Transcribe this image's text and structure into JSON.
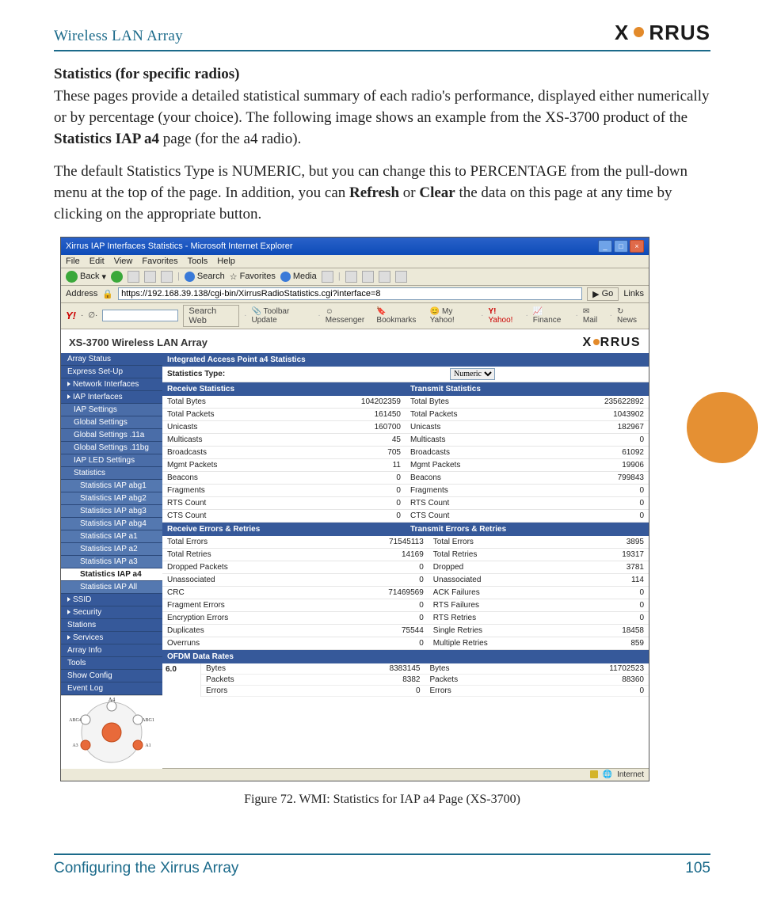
{
  "header": {
    "title": "Wireless LAN Array",
    "logo_pre": "X",
    "logo_post": "RRUS"
  },
  "footer": {
    "section": "Configuring the Xirrus Array",
    "page": "105"
  },
  "content": {
    "heading": "Statistics (for specific radios)",
    "p1a": "These pages provide a detailed statistical summary of each radio's performance, displayed either numerically or by percentage (your choice). The following image shows an example from the XS-3700 product of the ",
    "p1b": "Statistics IAP a4",
    "p1c": " page (for the a4 radio).",
    "p2a": "The default Statistics Type is NUMERIC, but you can change this to PERCENTAGE from the pull-down menu at the top of the page. In addition, you can ",
    "p2b": "Refresh",
    "p2c": " or ",
    "p2d": "Clear",
    "p2e": " the data on this page at any time by clicking on the appropriate button.",
    "caption": "Figure 72. WMI: Statistics for IAP a4 Page (XS-3700)"
  },
  "figure": {
    "window_title": "Xirrus IAP Interfaces Statistics - Microsoft Internet Explorer",
    "menubar": [
      "File",
      "Edit",
      "View",
      "Favorites",
      "Tools",
      "Help"
    ],
    "toolbar": {
      "back": "Back",
      "search": "Search",
      "favorites": "Favorites",
      "media": "Media"
    },
    "address_label": "Address",
    "address_value": "https://192.168.39.138/cgi-bin/XirrusRadioStatistics.cgi?interface=8",
    "go_label": "Go",
    "links_label": "Links",
    "ybar": {
      "search_btn": "Search Web",
      "items": [
        "Toolbar Update",
        "Messenger",
        "Bookmarks",
        "My Yahoo!",
        "Yahoo!",
        "Finance",
        "Mail",
        "News"
      ]
    },
    "array_name": "XS-3700 Wireless LAN Array",
    "sidebar": [
      {
        "t": "Array Status",
        "lvl": 0,
        "tri": false
      },
      {
        "t": "Express Set-Up",
        "lvl": 0,
        "tri": false
      },
      {
        "t": "Network Interfaces",
        "lvl": 0,
        "tri": true
      },
      {
        "t": "IAP Interfaces",
        "lvl": 0,
        "tri": true
      },
      {
        "t": "IAP Settings",
        "lvl": 1
      },
      {
        "t": "Global Settings",
        "lvl": 1
      },
      {
        "t": "Global Settings .11a",
        "lvl": 1
      },
      {
        "t": "Global Settings .11bg",
        "lvl": 1
      },
      {
        "t": "IAP LED Settings",
        "lvl": 1
      },
      {
        "t": "Statistics",
        "lvl": 1
      },
      {
        "t": "Statistics IAP abg1",
        "lvl": 2
      },
      {
        "t": "Statistics IAP abg2",
        "lvl": 2
      },
      {
        "t": "Statistics IAP abg3",
        "lvl": 2
      },
      {
        "t": "Statistics IAP abg4",
        "lvl": 2
      },
      {
        "t": "Statistics IAP a1",
        "lvl": 2
      },
      {
        "t": "Statistics IAP a2",
        "lvl": 2
      },
      {
        "t": "Statistics IAP a3",
        "lvl": 2
      },
      {
        "t": "Statistics IAP a4",
        "lvl": 2,
        "sel": true
      },
      {
        "t": "Statistics IAP All",
        "lvl": 2
      },
      {
        "t": "SSID",
        "lvl": 0,
        "tri": true
      },
      {
        "t": "Security",
        "lvl": 0,
        "tri": true
      },
      {
        "t": "Stations",
        "lvl": 0
      },
      {
        "t": "Services",
        "lvl": 0,
        "tri": true
      },
      {
        "t": "Array Info",
        "lvl": 0
      },
      {
        "t": "Tools",
        "lvl": 0
      },
      {
        "t": "Show Config",
        "lvl": 0
      },
      {
        "t": "Event Log",
        "lvl": 0
      }
    ],
    "diagram_labels": {
      "top": "A4",
      "r1": "ABG1",
      "r2": "A1",
      "l1": "ABG4",
      "l2": "A3"
    },
    "panel": {
      "title": "Integrated Access Point a4 Statistics",
      "stat_type_label": "Statistics Type:",
      "stat_type_value": "Numeric",
      "rx_hdr": "Receive Statistics",
      "tx_hdr": "Transmit Statistics",
      "rx_err_hdr": "Receive Errors & Retries",
      "tx_err_hdr": "Transmit Errors & Retries",
      "receive": [
        {
          "l": "Total Bytes",
          "v": "104202359"
        },
        {
          "l": "Total Packets",
          "v": "161450"
        },
        {
          "l": "Unicasts",
          "v": "160700"
        },
        {
          "l": "Multicasts",
          "v": "45"
        },
        {
          "l": "Broadcasts",
          "v": "705"
        },
        {
          "l": "Mgmt Packets",
          "v": "11"
        },
        {
          "l": "Beacons",
          "v": "0"
        },
        {
          "l": "Fragments",
          "v": "0"
        },
        {
          "l": "RTS Count",
          "v": "0"
        },
        {
          "l": "CTS Count",
          "v": "0"
        }
      ],
      "transmit": [
        {
          "l": "Total Bytes",
          "v": "235622892"
        },
        {
          "l": "Total Packets",
          "v": "1043902"
        },
        {
          "l": "Unicasts",
          "v": "182967"
        },
        {
          "l": "Multicasts",
          "v": "0"
        },
        {
          "l": "Broadcasts",
          "v": "61092"
        },
        {
          "l": "Mgmt Packets",
          "v": "19906"
        },
        {
          "l": "Beacons",
          "v": "799843"
        },
        {
          "l": "Fragments",
          "v": "0"
        },
        {
          "l": "RTS Count",
          "v": "0"
        },
        {
          "l": "CTS Count",
          "v": "0"
        }
      ],
      "rx_err": [
        {
          "l": "Total Errors",
          "v": "71545113"
        },
        {
          "l": "Total Retries",
          "v": "14169"
        },
        {
          "l": "Dropped Packets",
          "v": "0"
        },
        {
          "l": "Unassociated",
          "v": "0"
        },
        {
          "l": "CRC",
          "v": "71469569"
        },
        {
          "l": "Fragment Errors",
          "v": "0"
        },
        {
          "l": "Encryption Errors",
          "v": "0"
        },
        {
          "l": "Duplicates",
          "v": "75544"
        },
        {
          "l": "Overruns",
          "v": "0"
        }
      ],
      "tx_err": [
        {
          "l": "Total Errors",
          "v": "3895"
        },
        {
          "l": "Total Retries",
          "v": "19317"
        },
        {
          "l": "Dropped",
          "v": "3781"
        },
        {
          "l": "Unassociated",
          "v": "114"
        },
        {
          "l": "ACK Failures",
          "v": "0"
        },
        {
          "l": "RTS Failures",
          "v": "0"
        },
        {
          "l": "RTS Retries",
          "v": "0"
        },
        {
          "l": "Single Retries",
          "v": "18458"
        },
        {
          "l": "Multiple Retries",
          "v": "859"
        }
      ],
      "ofdm_hdr": "OFDM Data Rates",
      "ofdm_rate": "6.0",
      "ofdm_rows": [
        {
          "l": "Bytes",
          "rv": "8383145",
          "tl": "Bytes",
          "tv": "11702523"
        },
        {
          "l": "Packets",
          "rv": "8382",
          "tl": "Packets",
          "tv": "88360"
        },
        {
          "l": "Errors",
          "rv": "0",
          "tl": "Errors",
          "tv": "0"
        }
      ],
      "status_text": "Internet"
    }
  }
}
